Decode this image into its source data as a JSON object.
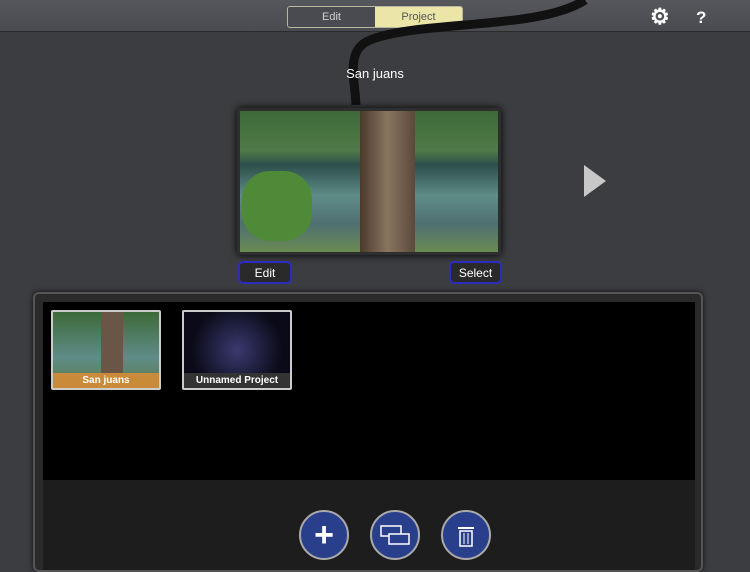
{
  "header": {
    "tabs": [
      {
        "label": "Edit",
        "active": false
      },
      {
        "label": "Project",
        "active": true
      }
    ],
    "settings_icon": "gear-icon",
    "help_label": "?"
  },
  "preview": {
    "title": "San juans",
    "edit_label": "Edit",
    "select_label": "Select"
  },
  "projects": [
    {
      "name": "San juans",
      "selected": true
    },
    {
      "name": "Unnamed Project",
      "selected": false
    }
  ],
  "toolbar": {
    "add": "plus-icon",
    "duplicate": "film-strips-icon",
    "delete": "trash-icon"
  },
  "colors": {
    "accent": "#ebe6a8",
    "button_blue": "#2a3f8c",
    "selected_label": "#c98a3a"
  }
}
